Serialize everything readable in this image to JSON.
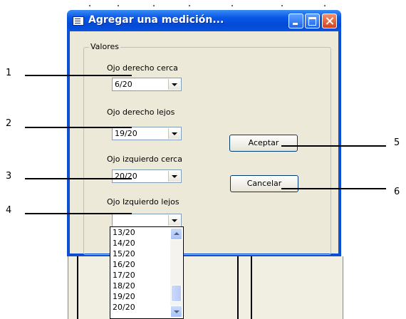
{
  "window": {
    "title": "Agregar una medición...",
    "group_label": "Valores"
  },
  "fields": [
    {
      "label": "Ojo derecho cerca",
      "value": "6/20"
    },
    {
      "label": "Ojo derecho lejos",
      "value": "19/20"
    },
    {
      "label": "Ojo izquierdo cerca",
      "value": "20/20"
    },
    {
      "label": "Ojo Izquierdo lejos",
      "value": ""
    }
  ],
  "buttons": {
    "accept": "Aceptar",
    "cancel": "Cancelar"
  },
  "dropdown_list": [
    "13/20",
    "14/20",
    "15/20",
    "16/20",
    "17/20",
    "18/20",
    "19/20",
    "20/20"
  ],
  "callouts": [
    "1",
    "2",
    "3",
    "4",
    "5",
    "6"
  ]
}
